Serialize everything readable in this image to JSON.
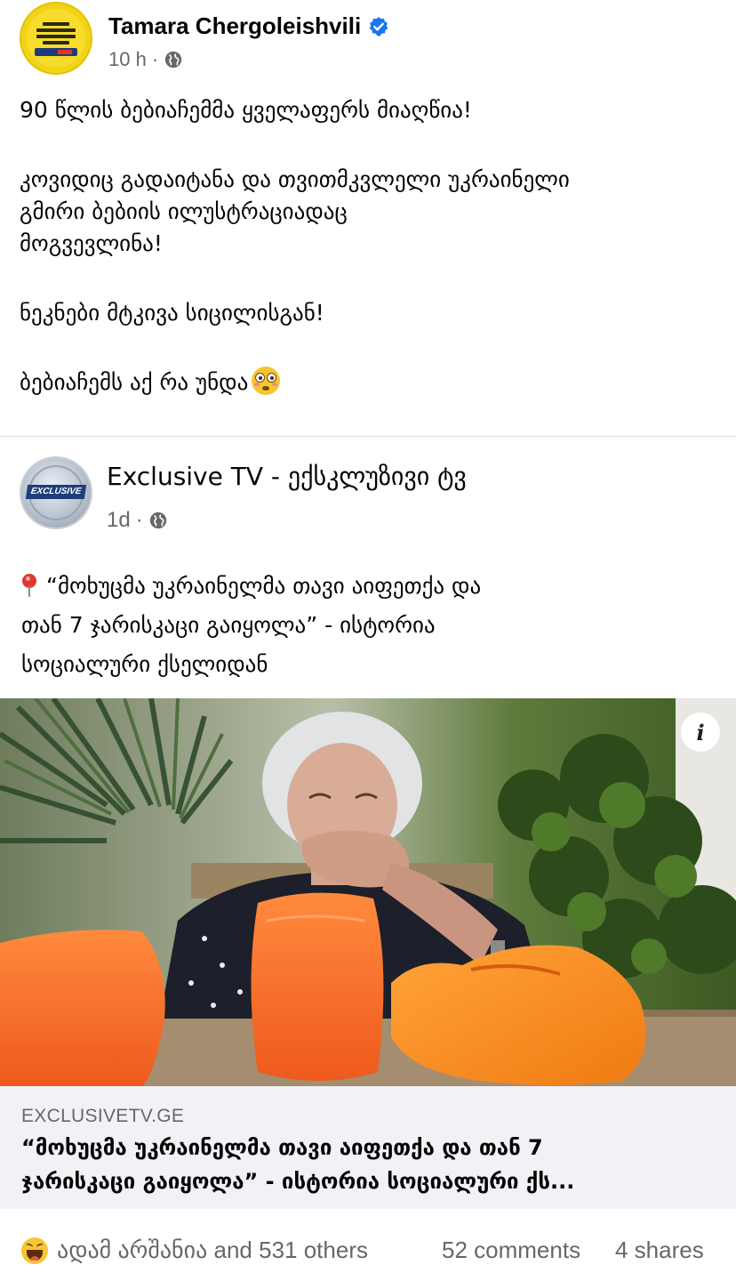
{
  "post": {
    "author": "Tamara Chergoleishvili",
    "verified": true,
    "time": "10 h",
    "meta_separator": "·",
    "privacy_icon": "globe-icon",
    "text": {
      "line1": "90 წლის ბებიაჩემმა ყველაფერს მიაღწია!",
      "line2": "კოვიდიც გადაიტანა და თვითმკვლელი უკრაინელი",
      "line3": "გმირი ბებიის ილუსტრაციადაც",
      "line4": "მოგვევლინა!",
      "line5": "ნეკნები მტკივა სიცილისგან!",
      "line6": "ბებიაჩემს აქ რა უნდა"
    },
    "emoji": "flushed-face-icon"
  },
  "shared_post": {
    "author": "Exclusive TV - ექსკლუზივი ტვ",
    "avatar_logo_text": "EXCLUSIVE",
    "time": "1d",
    "meta_separator": "·",
    "privacy_icon": "globe-icon",
    "text": {
      "line1": "“მოხუცმა უკრაინელმა თავი აიფეთქა და",
      "line2": "თან 7 ჯარისკაცი გაიყოლა” - ისტორია",
      "line3": "სოციალური ქსელიდან"
    },
    "link": {
      "domain": "EXCLUSIVETV.GE",
      "title_line1": "“მოხუცმა უკრაინელმა თავი აიფეთქა და თან 7",
      "title_line2": "ჯარისკაცი გაიყოლა” - ისტორია სოციალური ქს..."
    },
    "info_button": "i"
  },
  "footer": {
    "reaction_icon": "haha-icon",
    "reactors": "ადამ არშანია and 531 others",
    "comments": "52 comments",
    "shares": "4 shares"
  },
  "colors": {
    "verified_blue": "#1877f2",
    "secondary_text": "#65676b",
    "link_box_bg": "#f0f2f5",
    "divider": "#dadde1"
  }
}
